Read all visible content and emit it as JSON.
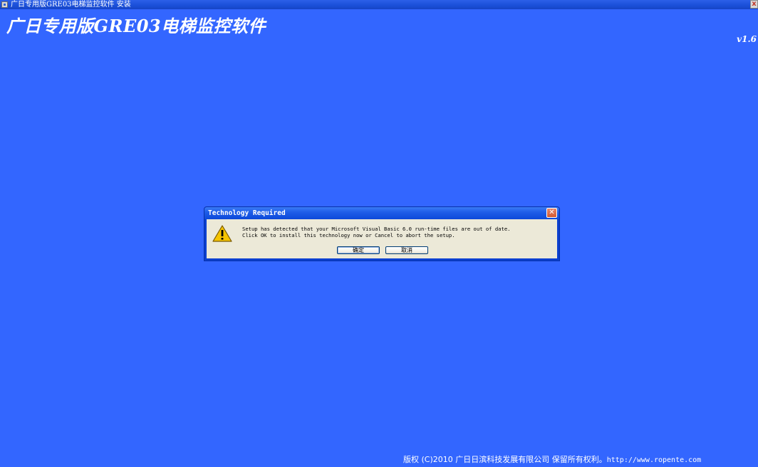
{
  "window": {
    "title": "广日专用版GRE03电梯监控软件 安装",
    "close_label": "x"
  },
  "installer": {
    "heading": "广日专用版GRE03电梯监控软件",
    "version": "v1.6",
    "footer_text": "版权 (C)2010 广日日滨科技发展有限公司 保留所有权利。",
    "footer_url": "http://www.ropente.com"
  },
  "dialog": {
    "title": "Technology Required",
    "close_label": "✕",
    "icon": "warning-icon",
    "message_line1": "Setup has detected that your Microsoft Visual Basic 6.0 run-time files are out of date.",
    "message_line2": "Click OK to install this technology now or Cancel to abort the setup.",
    "ok_label": "确定",
    "cancel_label": "取消"
  },
  "colors": {
    "background": "#3366ff",
    "titlebar": "#1a4fd8",
    "dialog_face": "#ece9d8"
  }
}
